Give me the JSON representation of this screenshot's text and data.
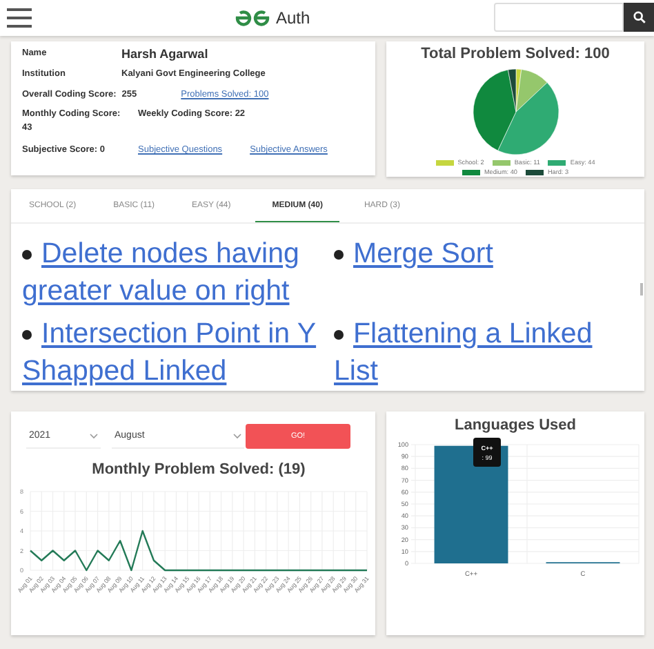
{
  "header": {
    "logo_text": "Auth"
  },
  "profile": {
    "name_label": "Name",
    "name": "Harsh Agarwal",
    "institution_label": "Institution",
    "institution": "Kalyani Govt Engineering College",
    "overall_label": "Overall Coding Score:",
    "overall": "255",
    "problems_link": "Problems Solved: 100",
    "monthly_label": "Monthly Coding Score:",
    "monthly": "43",
    "weekly": "Weekly Coding Score: 22",
    "subjective": "Subjective Score: 0",
    "links": [
      "Subjective Questions",
      "Subjective Answers"
    ]
  },
  "pie": {
    "chart_data": {
      "type": "pie",
      "title": "Total Problem Solved: 100",
      "categories": [
        "School: 2",
        "Basic: 11",
        "Easy: 44",
        "Medium: 40",
        "Hard: 3"
      ],
      "values": [
        2,
        11,
        44,
        40,
        3
      ]
    },
    "legend": [
      {
        "color": "#c5d63f"
      },
      {
        "color": "#95c76c"
      },
      {
        "color": "#2fab73"
      },
      {
        "color": "#10893e"
      },
      {
        "color": "#1c4b3a"
      }
    ]
  },
  "tabs": [
    {
      "label": "SCHOOL (2)",
      "selected": false
    },
    {
      "label": "BASIC (11)",
      "selected": false
    },
    {
      "label": "EASY (44)",
      "selected": false
    },
    {
      "label": "MEDIUM (40)",
      "selected": true
    },
    {
      "label": "HARD (3)",
      "selected": false
    }
  ],
  "problems": [
    "Delete nodes having greater value on right",
    "Merge Sort",
    "Intersection Point in Y Shapped Linked",
    "Flattening a Linked List"
  ],
  "monthly": {
    "year": "2021",
    "month": "August",
    "go": "GO!",
    "chart_data": {
      "type": "line",
      "title": "Monthly Problem Solved: (19)",
      "categories": [
        "Aug 01",
        "Aug 02",
        "Aug 03",
        "Aug 04",
        "Aug 05",
        "Aug 06",
        "Aug 07",
        "Aug 08",
        "Aug 09",
        "Aug 10",
        "Aug 11",
        "Aug 12",
        "Aug 13",
        "Aug 14",
        "Aug 15",
        "Aug 16",
        "Aug 17",
        "Aug 18",
        "Aug 19",
        "Aug 20",
        "Aug 21",
        "Aug 22",
        "Aug 23",
        "Aug 24",
        "Aug 25",
        "Aug 26",
        "Aug 27",
        "Aug 28",
        "Aug 29",
        "Aug 30",
        "Aug 31"
      ],
      "values": [
        2,
        1,
        2,
        1,
        2,
        0,
        2,
        1,
        3,
        0,
        4,
        1,
        0,
        0,
        0,
        0,
        0,
        0,
        0,
        0,
        0,
        0,
        0,
        0,
        0,
        0,
        0,
        0,
        0,
        0,
        0
      ],
      "ylim": [
        0,
        8
      ],
      "yticks": [
        0,
        2,
        4,
        6,
        8
      ],
      "grid": true
    }
  },
  "languages": {
    "chart_data": {
      "type": "bar",
      "title": "Languages Used",
      "categories": [
        "C++",
        "C"
      ],
      "values": [
        99,
        1
      ],
      "ylim": [
        0,
        100
      ],
      "yticks": [
        0,
        10,
        20,
        30,
        40,
        50,
        60,
        70,
        80,
        90,
        100
      ],
      "grid": true
    },
    "tooltip": {
      "title": "C++",
      "body": ": 99"
    }
  }
}
